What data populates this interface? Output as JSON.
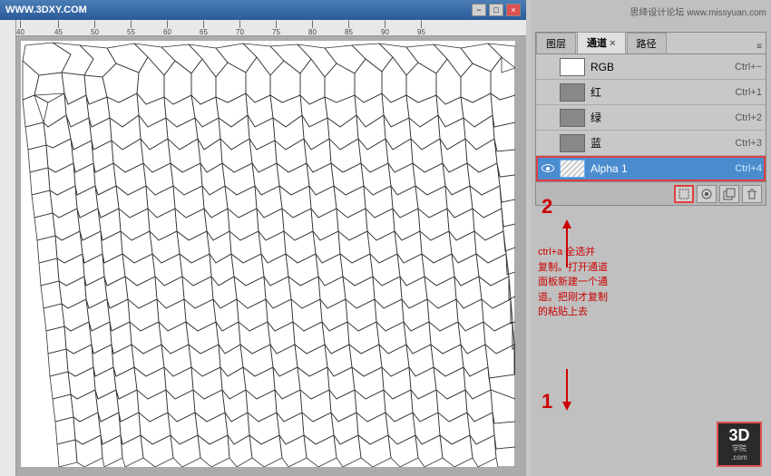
{
  "window": {
    "title": "WWW.3DXY.COM",
    "branding_top": "思绛设计论坛 www.missyuan.com"
  },
  "ruler": {
    "marks": [
      "40",
      "45",
      "50",
      "55",
      "60",
      "65",
      "70",
      "75",
      "80",
      "85",
      "90",
      "95"
    ]
  },
  "panel": {
    "tabs": [
      {
        "label": "图层",
        "active": false
      },
      {
        "label": "通道",
        "active": true,
        "closable": true
      },
      {
        "label": "路径",
        "active": false
      }
    ],
    "menu_icon": "≡",
    "channels": [
      {
        "name": "RGB",
        "shortcut": "Ctrl+~",
        "selected": false,
        "thumb_type": "white",
        "has_eye": false
      },
      {
        "name": "红",
        "shortcut": "Ctrl+1",
        "selected": false,
        "thumb_type": "gray",
        "has_eye": false
      },
      {
        "name": "绿",
        "shortcut": "Ctrl+2",
        "selected": false,
        "thumb_type": "gray",
        "has_eye": false
      },
      {
        "name": "蓝",
        "shortcut": "Ctrl+3",
        "selected": false,
        "thumb_type": "gray",
        "has_eye": false
      },
      {
        "name": "Alpha 1",
        "shortcut": "Ctrl+4",
        "selected": true,
        "thumb_type": "alpha",
        "has_eye": true
      }
    ],
    "toolbar_icons": [
      "circle-dotted",
      "new-channel",
      "trash"
    ],
    "annotation": {
      "number_2": "2",
      "arrow_up": "↑",
      "text": "ctrl+a 全选并\n复制。打开通道\n面板新建一个通\n道。把刚才复制\n的粘贴上去",
      "number_1": "1",
      "arrow_down": "↑"
    }
  },
  "logo": {
    "main": "3D",
    "sub": "学院",
    "site": ".com"
  },
  "title_controls": {
    "minimize": "−",
    "maximize": "□",
    "close": "×"
  }
}
